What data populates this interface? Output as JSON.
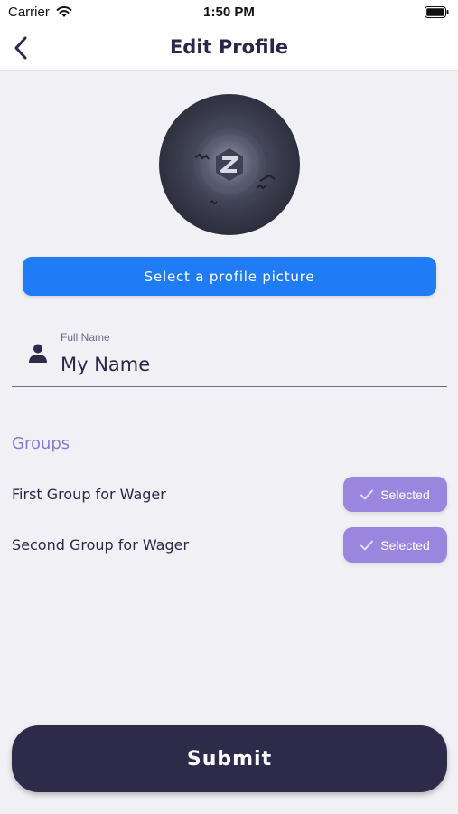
{
  "status_bar": {
    "carrier": "Carrier",
    "time": "1:50 PM",
    "icons": [
      "wifi-icon",
      "battery-icon"
    ]
  },
  "nav": {
    "title": "Edit Profile",
    "back_icon": "chevron-left-icon"
  },
  "profile": {
    "avatar_icon": "profile-picture-avatar",
    "select_picture_label": "Select a profile picture"
  },
  "form": {
    "full_name_label": "Full Name",
    "full_name_value": "My Name",
    "full_name_icon": "person-icon"
  },
  "groups": {
    "title": "Groups",
    "items": [
      {
        "name": "First Group for Wager",
        "status": "Selected"
      },
      {
        "name": "Second Group for Wager",
        "status": "Selected"
      }
    ]
  },
  "actions": {
    "submit_label": "Submit"
  },
  "colors": {
    "primary_blue": "#1f7cf4",
    "accent_purple": "#9b86df",
    "groups_title": "#8b79d8",
    "dark_navy": "#2d2a4a",
    "background": "#f1f0f4"
  }
}
